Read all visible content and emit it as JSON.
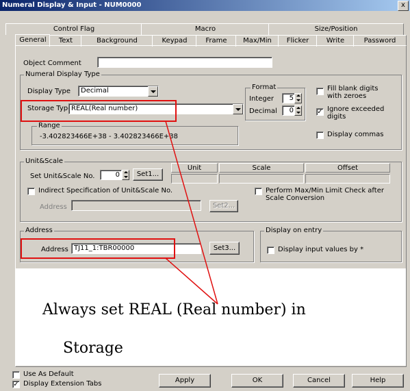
{
  "window": {
    "title": "Numeral Display & Input - NUM0000",
    "close_label": "x"
  },
  "tabs_top": [
    {
      "label": "Control Flag"
    },
    {
      "label": "Macro"
    },
    {
      "label": "Size/Position"
    }
  ],
  "tabs_bottom": [
    {
      "label": "General"
    },
    {
      "label": "Text"
    },
    {
      "label": "Background"
    },
    {
      "label": "Keypad"
    },
    {
      "label": "Frame"
    },
    {
      "label": "Max/Min"
    },
    {
      "label": "Flicker"
    },
    {
      "label": "Write"
    },
    {
      "label": "Password"
    }
  ],
  "object_comment": {
    "label": "Object Comment",
    "value": ""
  },
  "numeral_display_type": {
    "legend": "Numeral Display Type",
    "display_type_label": "Display Type",
    "display_type_value": "Decimal",
    "storage_type_label": "Storage Type",
    "storage_type_value": "REAL(Real number)",
    "range_legend": "Range",
    "range_value": "-3.402823466E+38 - 3.402823466E+38"
  },
  "format": {
    "legend": "Format",
    "integer_label": "Integer",
    "integer_value": "5",
    "decimal_label": "Decimal",
    "decimal_value": "0"
  },
  "options": {
    "fill_blank_line1": "Fill blank digits",
    "fill_blank_line2": "with zeroes",
    "fill_blank_checked": false,
    "ignore_exceeded_line1": "Ignore exceeded",
    "ignore_exceeded_line2": "digits",
    "ignore_exceeded_checked": true,
    "display_commas_label": "Display commas",
    "display_commas_checked": false
  },
  "unit_scale": {
    "legend": "Unit&Scale",
    "set_no_label": "Set Unit&Scale No.",
    "set_no_value": "0",
    "set1_label": "Set1...",
    "col_unit": "Unit",
    "col_scale": "Scale",
    "col_offset": "Offset",
    "indirect_label": "Indirect Specification of Unit&Scale No.",
    "indirect_checked": false,
    "address_label": "Address",
    "set2_label": "Set2...",
    "limit_check_line1": "Perform Max/Min Limit Check after",
    "limit_check_line2": "Scale Conversion",
    "limit_check_checked": false
  },
  "address_group": {
    "legend": "Address",
    "address_label": "Address",
    "address_value": "TJ11_1:TBR00000",
    "set3_label": "Set3..."
  },
  "display_on_entry": {
    "legend": "Display on entry",
    "display_input_label": "Display input values by *",
    "display_input_checked": false
  },
  "annotation": {
    "line1": "Always set REAL (Real number) in",
    "line2": "Storage",
    "highlight_color": "#e01010"
  },
  "footer": {
    "use_as_default_label": "Use As Default",
    "use_as_default_checked": false,
    "display_ext_tabs_label": "Display Extension Tabs",
    "display_ext_tabs_checked": true,
    "apply_label": "Apply",
    "ok_label": "OK",
    "cancel_label": "Cancel",
    "help_label": "Help"
  }
}
